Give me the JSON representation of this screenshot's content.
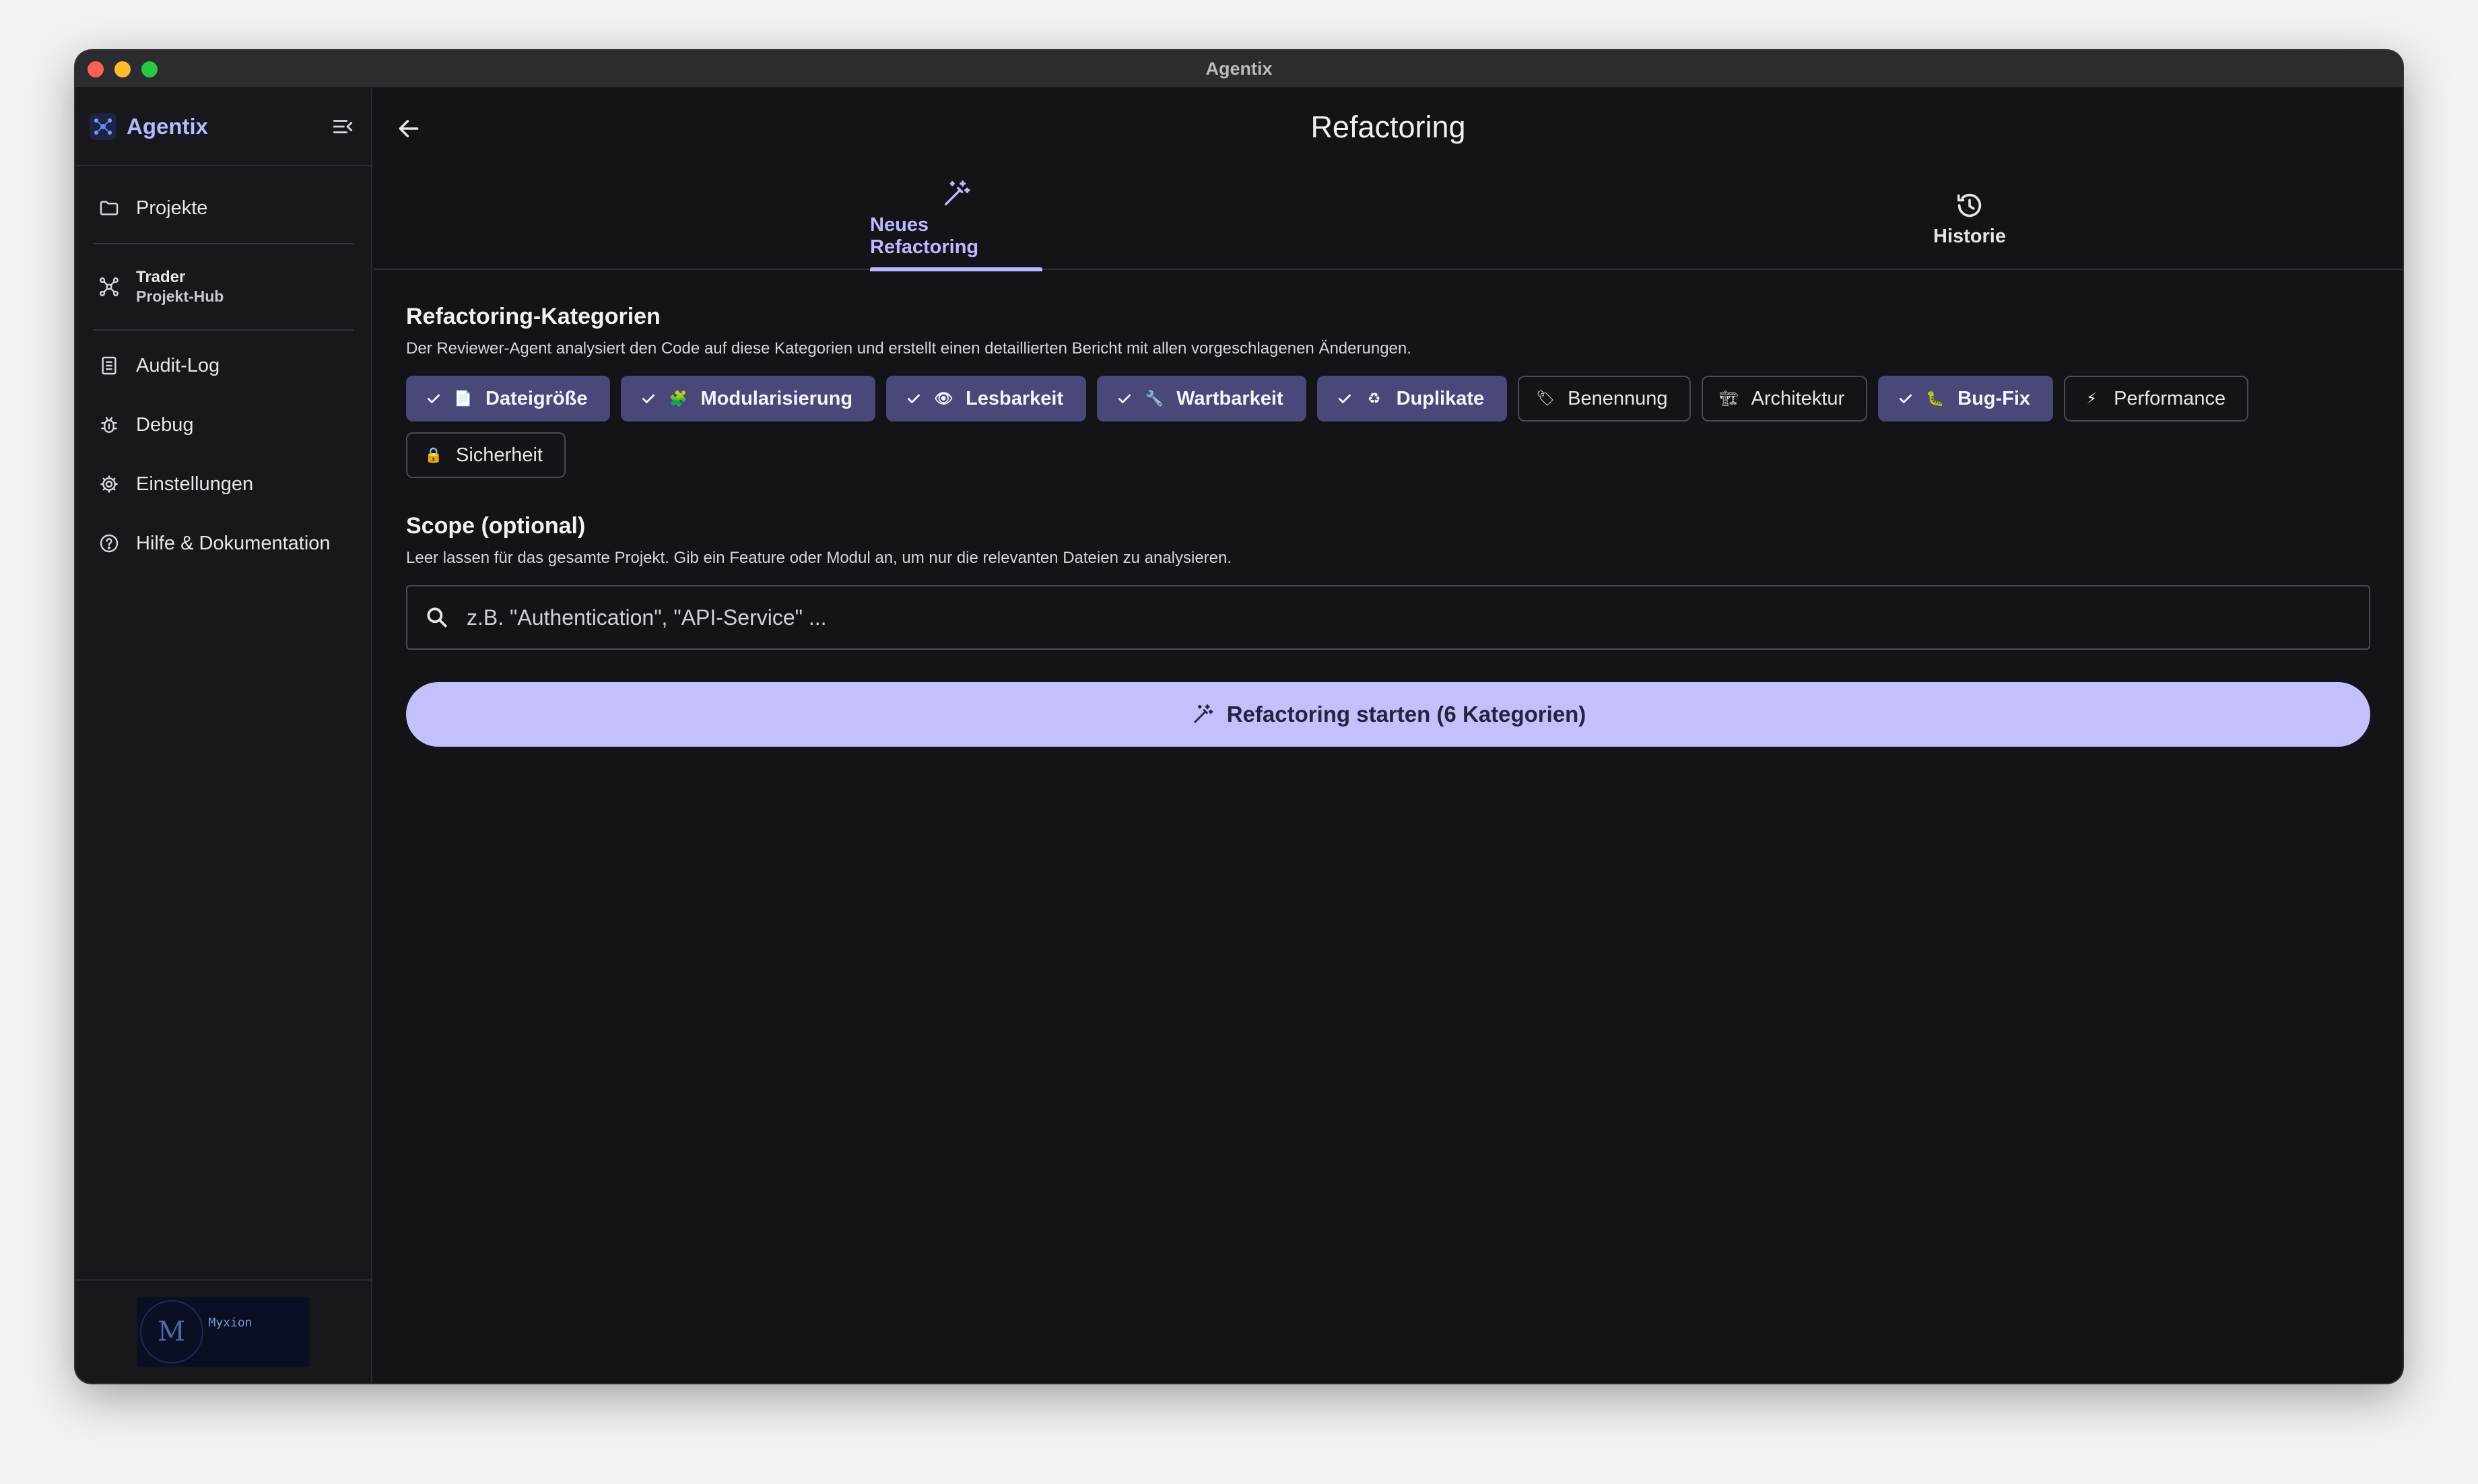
{
  "window": {
    "title": "Agentix"
  },
  "sidebar": {
    "brand": "Agentix",
    "items": [
      {
        "label": "Projekte",
        "icon": "folder-icon"
      },
      {
        "label_line1": "Trader",
        "label_line2": "Projekt-Hub",
        "icon": "hub-icon"
      },
      {
        "label": "Audit-Log",
        "icon": "audit-log-icon"
      },
      {
        "label": "Debug",
        "icon": "bug-icon"
      },
      {
        "label": "Einstellungen",
        "icon": "gear-icon"
      },
      {
        "label": "Hilfe & Dokumentation",
        "icon": "help-icon"
      }
    ],
    "footer_logo_text": "Myxion"
  },
  "header": {
    "title": "Refactoring"
  },
  "tabs": [
    {
      "label": "Neues Refactoring",
      "icon": "magic-wand-icon",
      "active": true
    },
    {
      "label": "Historie",
      "icon": "history-icon",
      "active": false
    }
  ],
  "categories": {
    "title": "Refactoring-Kategorien",
    "description": "Der Reviewer-Agent analysiert den Code auf diese Kategorien und erstellt einen detaillierten Bericht mit allen vorgeschlagenen Änderungen.",
    "chips": [
      {
        "label": "Dateigröße",
        "emoji": "📄",
        "selected": true
      },
      {
        "label": "Modularisierung",
        "emoji": "🧩",
        "selected": true
      },
      {
        "label": "Lesbarkeit",
        "emoji": "👁",
        "selected": true
      },
      {
        "label": "Wartbarkeit",
        "emoji": "🔧",
        "selected": true
      },
      {
        "label": "Duplikate",
        "emoji": "♻",
        "selected": true
      },
      {
        "label": "Benennung",
        "emoji": "🏷",
        "selected": false
      },
      {
        "label": "Architektur",
        "emoji": "🏗",
        "selected": false
      },
      {
        "label": "Bug-Fix",
        "emoji": "🐛",
        "selected": true
      },
      {
        "label": "Performance",
        "emoji": "⚡",
        "selected": false
      },
      {
        "label": "Sicherheit",
        "emoji": "🔒",
        "selected": false
      }
    ]
  },
  "scope": {
    "title": "Scope (optional)",
    "description": "Leer lassen für das gesamte Projekt. Gib ein Feature oder Modul an, um nur die relevanten Dateien zu analysieren.",
    "placeholder": "z.B. \"Authentication\", \"API-Service\" ...",
    "value": ""
  },
  "start_button": {
    "label": "Refactoring starten (6 Kategorien)"
  },
  "colors": {
    "accent": "#bdb8ff",
    "chip_selected_bg": "#4a4779",
    "button_bg": "#c4c0fb",
    "background": "#131318",
    "sidebar_bg": "#17171c"
  }
}
